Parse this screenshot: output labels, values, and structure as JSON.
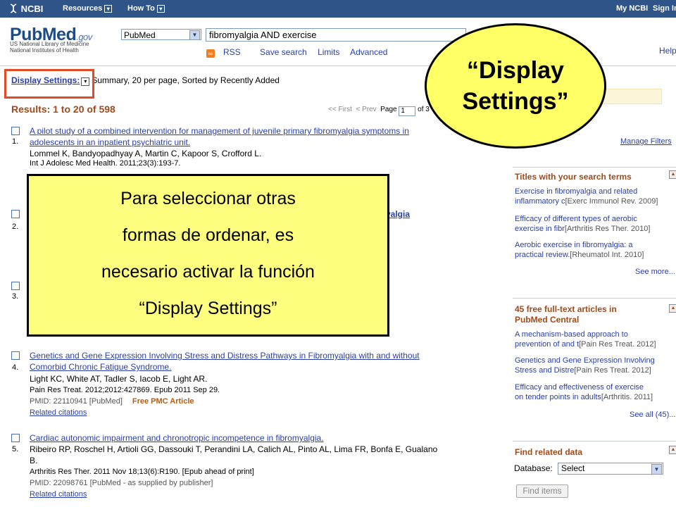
{
  "topbar": {
    "brand": "NCBI",
    "resources": "Resources",
    "howto": "How To",
    "my_ncbi": "My NCBI",
    "sign_in": "Sign In"
  },
  "header": {
    "logo": "PubMed",
    "logo_suffix": ".gov",
    "logo_sub1": "US National Library of Medicine",
    "logo_sub2": "National Institutes of Health",
    "database": "PubMed",
    "query": "fibromyalgia AND exercise",
    "links": [
      "RSS",
      "Save search",
      "Limits",
      "Advanced"
    ],
    "help": "Help"
  },
  "display_settings": {
    "label": "Display Settings:",
    "summary": "Summary, 20 per page, Sorted by Recently Added"
  },
  "results": {
    "count_text": "Results: 1 to 20 of 598",
    "pager": {
      "first": "<< First",
      "prev": "< Prev",
      "page_label": "Page",
      "page_value": "1",
      "of": "of 3"
    },
    "items": [
      {
        "num": "1.",
        "title_line1": "A pilot study of a combined intervention for management of juvenile primary fibromyalgia symptoms in",
        "title_line2": "adolescents in an inpatient psychiatric unit.",
        "authors": "Lommel K, Bandyopadhyay A, Martin C, Kapoor S, Crofford L.",
        "source": "Int J Adolesc Med Health. 2011;23(3):193-7."
      },
      {
        "num": "2.",
        "title_fragment": "yalgia"
      },
      {
        "num": "3."
      },
      {
        "num": "4.",
        "title_line1": "Genetics and Gene Expression Involving Stress and Distress Pathways in Fibromyalgia with and without",
        "title_line2": "Comorbid Chronic Fatigue Syndrome.",
        "authors": "Light KC, White AT, Tadler S, Iacob E, Light AR.",
        "source": "Pain Res Treat. 2012;2012:427869. Epub 2011 Sep 29.",
        "pmid": "PMID: 22110941 [PubMed]",
        "pmc": "Free PMC Article",
        "related": "Related citations"
      },
      {
        "num": "5.",
        "title_line1": "Cardiac autonomic impairment and chronotropic incompetence in fibromyalgia.",
        "authors_line1": "Ribeiro RP, Roschel H, Artioli GG, Dassouki T, Perandini LA, Calich AL, Pinto AL, Lima FR, Bonfa E, Gualano",
        "authors_line2": "B.",
        "source": "Arthritis Res Ther. 2011 Nov 18;13(6):R190. [Epub ahead of print]",
        "pmid": "PMID: 22098761 [PubMed - as supplied by publisher]",
        "related": "Related citations"
      }
    ]
  },
  "sidebar": {
    "manage_filters": "Manage Filters",
    "titles_head": "Titles with your search terms",
    "titles_items": [
      {
        "l1": "Exercise in fibromyalgia and related",
        "l2": "inflammatory c",
        "src": "[Exerc Immunol Rev. 2009]"
      },
      {
        "l1": "Efficacy of different types of aerobic",
        "l2": "exercise in fibr",
        "src": "[Arthritis Res Ther. 2010]"
      },
      {
        "l1": "Aerobic exercise in fibromyalgia: a",
        "l2": "practical review.",
        "src": "[Rheumatol Int. 2010]"
      }
    ],
    "see_more": "See more...",
    "free_head1": "45 free full-text articles in",
    "free_head2": "PubMed Central",
    "free_items": [
      {
        "l1": "A mechanism-based approach to",
        "l2": "prevention of and t",
        "src": "[Pain Res Treat. 2012]"
      },
      {
        "l1": "Genetics and Gene Expression Involving",
        "l2": "Stress and Distre",
        "src": "[Pain Res Treat. 2012]"
      },
      {
        "l1": "Efficacy and effectiveness of exercise",
        "l2": "on tender points in adults",
        "src": "[Arthritis. 2011]"
      }
    ],
    "see_all": "See all (45)...",
    "find_head": "Find related data",
    "db_label": "Database:",
    "db_value": "Select",
    "find_button": "Find items"
  },
  "overlays": {
    "bubble": "“Display Settings”",
    "callout_lines": [
      "Para seleccionar otras",
      "formas de ordenar, es",
      "necesario activar la función",
      "“Display Settings”"
    ]
  }
}
